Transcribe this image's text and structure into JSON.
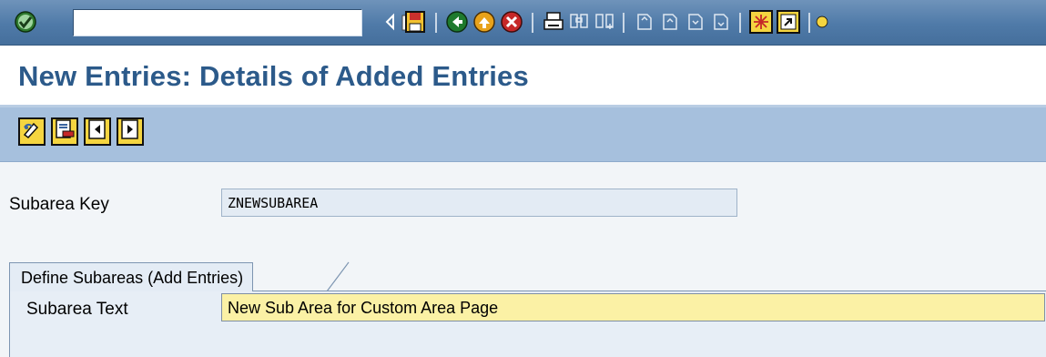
{
  "system_toolbar": {
    "icons": [
      "enter-checkmark-icon",
      "command-history-icon",
      "triangle-left-icon",
      "save-icon",
      "back-icon",
      "exit-icon",
      "cancel-icon",
      "print-icon",
      "find-icon",
      "find-next-icon",
      "first-page-icon",
      "previous-page-icon",
      "next-page-icon",
      "last-page-icon",
      "create-session-icon",
      "shortcut-icon"
    ],
    "command_field_value": ""
  },
  "title": {
    "text": "New Entries: Details of Added Entries"
  },
  "app_toolbar": {
    "buttons": [
      {
        "icon": "change-display-icon"
      },
      {
        "icon": "delete-icon"
      },
      {
        "icon": "previous-entry-icon"
      },
      {
        "icon": "next-entry-icon"
      }
    ]
  },
  "form": {
    "subarea_key_label": "Subarea Key",
    "subarea_key_value": "ZNEWSUBAREA",
    "tab_label": "Define Subareas (Add Entries)",
    "subarea_text_label": "Subarea Text",
    "subarea_text_value": "New Sub Area for Custom Area Page"
  },
  "colors": {
    "system_toolbar": "#4f7aa8",
    "title_text": "#2c5a8a",
    "app_toolbar": "#a6c0dd",
    "input_highlight": "#fbf1a5",
    "readonly_field": "#e3ebf4"
  }
}
